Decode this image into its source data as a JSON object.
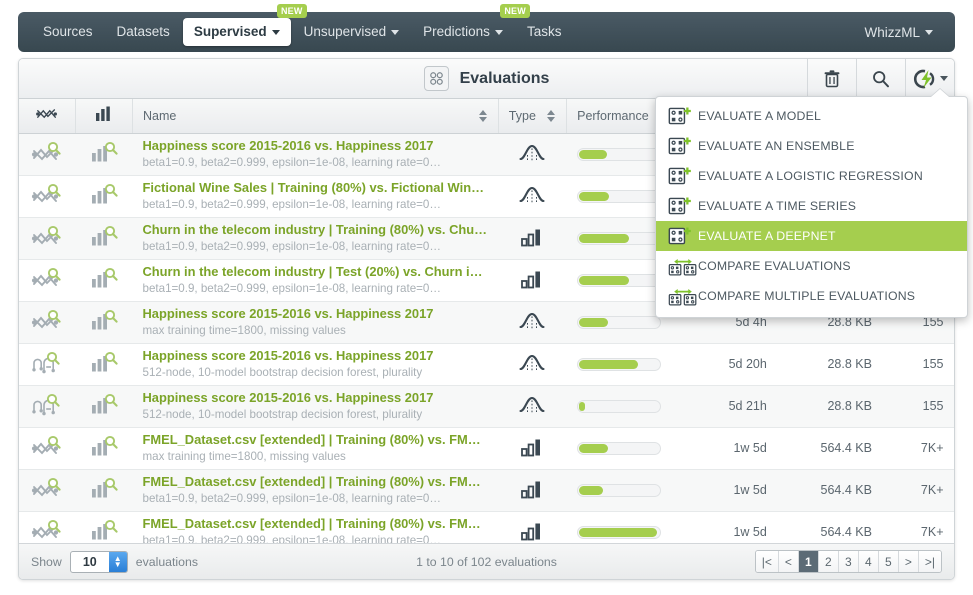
{
  "nav": {
    "items": [
      {
        "label": "Sources",
        "caret": false,
        "active": false,
        "badge": null
      },
      {
        "label": "Datasets",
        "caret": false,
        "active": false,
        "badge": null
      },
      {
        "label": "Supervised",
        "caret": true,
        "active": true,
        "badge": "NEW"
      },
      {
        "label": "Unsupervised",
        "caret": true,
        "active": false,
        "badge": null
      },
      {
        "label": "Predictions",
        "caret": true,
        "active": false,
        "badge": "NEW"
      },
      {
        "label": "Tasks",
        "caret": false,
        "active": false,
        "badge": null
      }
    ],
    "right": {
      "label": "WhizzML",
      "caret": true
    }
  },
  "panel": {
    "title": "Evaluations",
    "title_icon": "evaluations-grid-icon",
    "actions": [
      {
        "name": "delete-button",
        "icon": "trash-icon"
      },
      {
        "name": "search-button",
        "icon": "search-icon"
      },
      {
        "name": "create-evaluation-button",
        "icon": "lightning-bolt-icon"
      }
    ]
  },
  "table": {
    "columns": [
      {
        "key": "resource",
        "label": "",
        "icon": "deepnet-icon",
        "sortable": false
      },
      {
        "key": "evaluation",
        "label": "",
        "icon": "bar-chart-icon",
        "sortable": false
      },
      {
        "key": "name",
        "label": "Name",
        "sortable": true
      },
      {
        "key": "type",
        "label": "Type",
        "sortable": true
      },
      {
        "key": "performance",
        "label": "Performance",
        "sortable": false
      },
      {
        "key": "age",
        "label": "",
        "sortable": false
      },
      {
        "key": "size",
        "label": "",
        "sortable": false
      },
      {
        "key": "instances",
        "label": "",
        "sortable": false
      }
    ],
    "rows": [
      {
        "resource_icon": "deepnet-search-icon",
        "eval_icon": "evaluation-search-icon",
        "name": "Happiness score 2015-2016 vs. Happiness 2017",
        "subtitle": "beta1=0.9, beta2=0.999, epsilon=1e-08, learning rate=0…",
        "type_icon": "regression-curve-icon",
        "performance": 36,
        "age": "",
        "size": "",
        "instances": ""
      },
      {
        "resource_icon": "deepnet-search-icon",
        "eval_icon": "evaluation-search-icon",
        "name": "Fictional Wine Sales | Training (80%) vs. Fictional Win…",
        "subtitle": "beta1=0.9, beta2=0.999, epsilon=1e-08, learning rate=0…",
        "type_icon": "regression-curve-icon",
        "performance": 38,
        "age": "",
        "size": "",
        "instances": ""
      },
      {
        "resource_icon": "deepnet-search-icon",
        "eval_icon": "evaluation-search-icon",
        "name": "Churn in the telecom industry | Training (80%) vs. Chu…",
        "subtitle": "beta1=0.9, beta2=0.999, epsilon=1e-08, learning rate=0…",
        "type_icon": "classification-bars-icon",
        "performance": 63,
        "age": "",
        "size": "",
        "instances": ""
      },
      {
        "resource_icon": "deepnet-search-icon",
        "eval_icon": "evaluation-search-icon",
        "name": "Churn in the telecom industry | Test (20%) vs. Churn i…",
        "subtitle": "beta1=0.9, beta2=0.999, epsilon=1e-08, learning rate=0…",
        "type_icon": "classification-bars-icon",
        "performance": 63,
        "age": "",
        "size": "",
        "instances": ""
      },
      {
        "resource_icon": "deepnet-search-icon",
        "eval_icon": "evaluation-search-icon",
        "name": "Happiness score 2015-2016 vs. Happiness 2017",
        "subtitle": "max training time=1800, missing values",
        "type_icon": "regression-curve-icon",
        "performance": 37,
        "age": "5d 4h",
        "size": "28.8 KB",
        "instances": "155"
      },
      {
        "resource_icon": "ensemble-search-icon",
        "eval_icon": "evaluation-search-icon",
        "name": "Happiness score 2015-2016 vs. Happiness 2017",
        "subtitle": "512-node, 10-model bootstrap decision forest, plurality",
        "type_icon": "regression-curve-icon",
        "performance": 74,
        "age": "5d 20h",
        "size": "28.8 KB",
        "instances": "155"
      },
      {
        "resource_icon": "ensemble-search-icon",
        "eval_icon": "evaluation-search-icon",
        "name": "Happiness score 2015-2016 vs. Happiness 2017",
        "subtitle": "512-node, 10-model bootstrap decision forest, plurality",
        "type_icon": "regression-curve-icon",
        "performance": 8,
        "age": "5d 21h",
        "size": "28.8 KB",
        "instances": "155"
      },
      {
        "resource_icon": "deepnet-search-icon",
        "eval_icon": "evaluation-search-icon",
        "name": "FMEL_Dataset.csv [extended] | Training (80%) vs. FM…",
        "subtitle": "max training time=1800, missing values",
        "type_icon": "classification-bars-icon",
        "performance": 37,
        "age": "1w 5d",
        "size": "564.4 KB",
        "instances": "7K+"
      },
      {
        "resource_icon": "deepnet-search-icon",
        "eval_icon": "evaluation-search-icon",
        "name": "FMEL_Dataset.csv [extended] | Training (80%) vs. FM…",
        "subtitle": "beta1=0.9, beta2=0.999, epsilon=1e-08, learning rate=0…",
        "type_icon": "classification-bars-icon",
        "performance": 31,
        "age": "1w 5d",
        "size": "564.4 KB",
        "instances": "7K+"
      },
      {
        "resource_icon": "deepnet-search-icon",
        "eval_icon": "evaluation-search-icon",
        "name": "FMEL_Dataset.csv [extended] | Training (80%) vs. FM…",
        "subtitle": "beta1=0.9, beta2=0.999, epsilon=1e-08, learning rate=0…",
        "type_icon": "classification-bars-icon",
        "performance": 98,
        "age": "1w 5d",
        "size": "564.4 KB",
        "instances": "7K+"
      }
    ]
  },
  "footer": {
    "show_label": "Show",
    "show_value": "10",
    "show_suffix": "evaluations",
    "range_text": "1 to 10 of 102 evaluations",
    "pager": {
      "first": "|<",
      "prev": "<",
      "pages": [
        "1",
        "2",
        "3",
        "4",
        "5"
      ],
      "current": "1",
      "next": ">",
      "last": ">|"
    }
  },
  "dropdown": {
    "items": [
      {
        "label": "EVALUATE A MODEL",
        "icon": "evaluate-add-icon",
        "highlighted": false
      },
      {
        "label": "EVALUATE AN ENSEMBLE",
        "icon": "evaluate-add-icon",
        "highlighted": false
      },
      {
        "label": "EVALUATE A LOGISTIC REGRESSION",
        "icon": "evaluate-add-icon",
        "highlighted": false
      },
      {
        "label": "EVALUATE A TIME SERIES",
        "icon": "evaluate-add-icon",
        "highlighted": false
      },
      {
        "label": "EVALUATE A DEEPNET",
        "icon": "evaluate-add-icon",
        "highlighted": true
      },
      {
        "label": "COMPARE EVALUATIONS",
        "icon": "compare-icon",
        "highlighted": false
      },
      {
        "label": "COMPARE MULTIPLE EVALUATIONS",
        "icon": "compare-icon",
        "highlighted": false
      }
    ]
  },
  "colors": {
    "accent_green": "#a5ce4e",
    "name_green": "#7ba428",
    "nav_dark": "#3f4f5a",
    "pager_current": "#5c6b76"
  }
}
